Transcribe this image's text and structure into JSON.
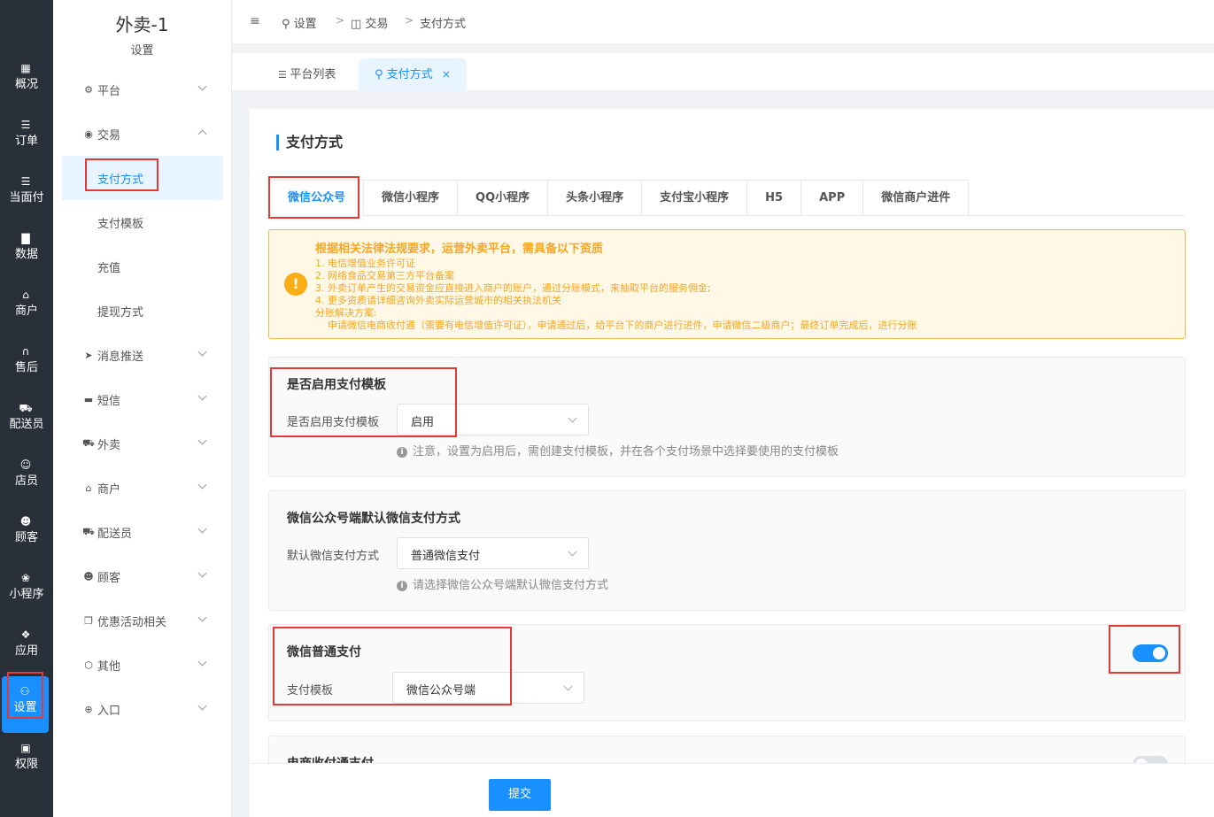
{
  "rail": {
    "items": [
      {
        "label": "概况",
        "icon": "grid-icon"
      },
      {
        "label": "订单",
        "icon": "list-icon"
      },
      {
        "label": "当面付",
        "icon": "list-icon"
      },
      {
        "label": "数据",
        "icon": "bar-chart-icon"
      },
      {
        "label": "商户",
        "icon": "store-icon"
      },
      {
        "label": "售后",
        "icon": "headset-icon"
      },
      {
        "label": "配送员",
        "icon": "scooter-icon"
      },
      {
        "label": "店员",
        "icon": "users-icon"
      },
      {
        "label": "顾客",
        "icon": "user-circle-icon"
      },
      {
        "label": "小程序",
        "icon": "wechat-icon"
      },
      {
        "label": "应用",
        "icon": "apps-icon"
      },
      {
        "label": "设置",
        "icon": "user-settings-icon"
      },
      {
        "label": "权限",
        "icon": "lock-icon"
      }
    ],
    "active_color": "#1890ff"
  },
  "submenu": {
    "title": "外卖-1",
    "subtitle": "设置",
    "items": [
      {
        "label": "平台",
        "icon": "gear-icon",
        "expanded": false
      },
      {
        "label": "交易",
        "icon": "wallet-icon",
        "expanded": true
      },
      {
        "label": "支付方式",
        "child": true,
        "selected": true
      },
      {
        "label": "支付模板",
        "child": true
      },
      {
        "label": "充值",
        "child": true
      },
      {
        "label": "提现方式",
        "child": true
      },
      {
        "label": "消息推送",
        "icon": "send-icon"
      },
      {
        "label": "短信",
        "icon": "message-icon"
      },
      {
        "label": "外卖",
        "icon": "scooter-icon"
      },
      {
        "label": "商户",
        "icon": "store-icon"
      },
      {
        "label": "配送员",
        "icon": "delivery-icon"
      },
      {
        "label": "顾客",
        "icon": "user-circle-icon"
      },
      {
        "label": "优惠活动相关",
        "icon": "gift-icon"
      },
      {
        "label": "其他",
        "icon": "hexagon-icon"
      },
      {
        "label": "入口",
        "icon": "entry-icon"
      }
    ]
  },
  "breadcrumb": {
    "items": [
      "设置",
      "交易",
      "支付方式"
    ],
    "separator": ">"
  },
  "page_tabs": [
    {
      "label": "平台列表",
      "icon": "list-icon"
    },
    {
      "label": "支付方式",
      "icon": "user-settings-icon",
      "closable": true,
      "close": "×"
    }
  ],
  "section": {
    "title": "支付方式"
  },
  "pay_tabs": [
    "微信公众号",
    "微信小程序",
    "QQ小程序",
    "头条小程序",
    "支付宝小程序",
    "H5",
    "APP",
    "微信商户进件"
  ],
  "alert": {
    "icon": "!",
    "title": "根据相关法律法规要求，运营外卖平台，需具备以下资质",
    "lines": [
      "1. 电信增值业务许可证",
      "2. 网络食品交易第三方平台备案",
      "3. 外卖订单产生的交易资金应直接进入商户的账户，通过分账模式，来抽取平台的服务佣金;",
      "4. 更多资质请详细咨询外卖实际运营城市的相关执法机关",
      "分账解决方案:",
      "    申请微信电商收付通（需要有电信增值许可证），申请通过后，给平台下的商户进行进件，申请微信二级商户；最终订单完成后，进行分账"
    ],
    "color": "#f5a623"
  },
  "card_template": {
    "title": "是否启用支付模板",
    "field_label": "是否启用支付模板",
    "value": "启用",
    "hint": "注意，设置为启用后，需创建支付模板，并在各个支付场景中选择要使用的支付模板"
  },
  "card_default": {
    "title": "微信公众号端默认微信支付方式",
    "field_label": "默认微信支付方式",
    "value": "普通微信支付",
    "hint": "请选择微信公众号端默认微信支付方式"
  },
  "card_wechat": {
    "title": "微信普通支付",
    "field_label": "支付模板",
    "value": "微信公众号端",
    "enabled": true,
    "on_color": "#1890ff"
  },
  "card_ecommerce": {
    "title": "电商收付通支付",
    "enabled": false,
    "off_color": "#dcdfe6"
  },
  "footer": {
    "submit_label": "提交"
  },
  "highlight_color": "#e53935"
}
